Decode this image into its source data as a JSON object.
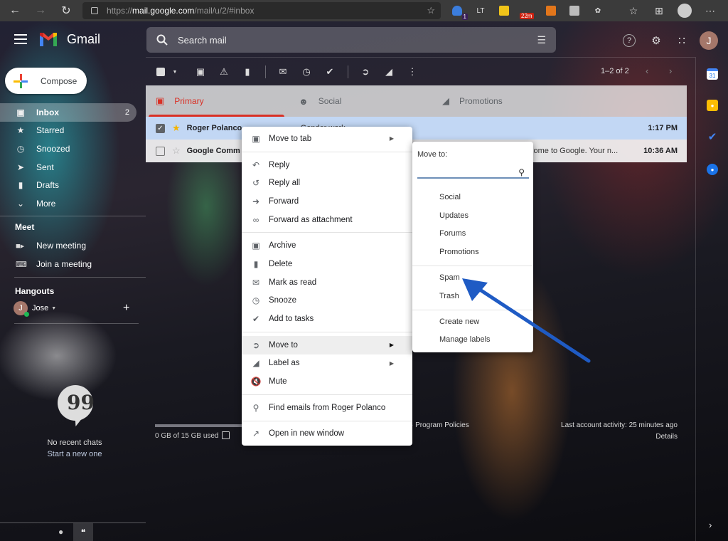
{
  "browser": {
    "url_prefix": "https://",
    "url_host": "mail.google.com",
    "url_path": "/mail/u/2/#inbox",
    "extensions": [
      {
        "name": "ext-blue",
        "badge": "1",
        "color": "#3b7ddd"
      },
      {
        "name": "ext-languagetool",
        "label": "LT"
      },
      {
        "name": "ext-yellow",
        "color": "#f0c419"
      },
      {
        "name": "ext-timer",
        "badge": "22m"
      },
      {
        "name": "ext-metamask",
        "color": "#e2761b"
      },
      {
        "name": "ext-gray",
        "color": "#bbbbbb"
      },
      {
        "name": "ext-puzzle"
      }
    ]
  },
  "gmail": {
    "app_name": "Gmail",
    "search_placeholder": "Search mail",
    "avatar_letter": "J"
  },
  "sidebar": {
    "compose": "Compose",
    "items": [
      {
        "label": "Inbox",
        "count": "2",
        "icon": "inbox-icon",
        "active": true
      },
      {
        "label": "Starred",
        "icon": "star-icon"
      },
      {
        "label": "Snoozed",
        "icon": "clock-icon"
      },
      {
        "label": "Sent",
        "icon": "send-icon"
      },
      {
        "label": "Drafts",
        "icon": "draft-icon"
      },
      {
        "label": "More",
        "icon": "chevron-down-icon"
      }
    ],
    "meet": {
      "title": "Meet",
      "new_meeting": "New meeting",
      "join_meeting": "Join a meeting"
    },
    "hangouts": {
      "title": "Hangouts",
      "user": "Jose",
      "user_initial": "J",
      "no_chats": "No recent chats",
      "start_new": "Start a new one"
    }
  },
  "toolbar": {
    "pager": "1–2 of 2"
  },
  "tabs": [
    {
      "label": "Primary",
      "active": true
    },
    {
      "label": "Social"
    },
    {
      "label": "Promotions"
    }
  ],
  "emails": [
    {
      "from": "Roger Polanco",
      "subject": "Gender work",
      "time": "1:17 PM",
      "selected": true,
      "starred": true
    },
    {
      "from": "Google Comm",
      "subject": "come to Google. Your n...",
      "time": "10:36 AM",
      "selected": false,
      "starred": false
    }
  ],
  "footer": {
    "storage": "0 GB of 15 GB used",
    "storage_used_fraction": 0,
    "policies": "· Program Policies",
    "activity": "Last account activity: 25 minutes ago",
    "details": "Details"
  },
  "context_menu": {
    "groups": [
      [
        {
          "label": "Move to tab",
          "submenu": true,
          "icon": "move-to-tab-icon"
        }
      ],
      [
        {
          "label": "Reply",
          "icon": "reply-icon"
        },
        {
          "label": "Reply all",
          "icon": "reply-all-icon"
        },
        {
          "label": "Forward",
          "icon": "forward-icon"
        },
        {
          "label": "Forward as attachment",
          "icon": "attachment-icon"
        }
      ],
      [
        {
          "label": "Archive",
          "icon": "archive-icon"
        },
        {
          "label": "Delete",
          "icon": "trash-icon"
        },
        {
          "label": "Mark as read",
          "icon": "mark-read-icon"
        },
        {
          "label": "Snooze",
          "icon": "clock-icon"
        },
        {
          "label": "Add to tasks",
          "icon": "add-task-icon"
        }
      ],
      [
        {
          "label": "Move to",
          "submenu": true,
          "highlighted": true,
          "icon": "move-to-icon"
        },
        {
          "label": "Label as",
          "submenu": true,
          "icon": "label-icon"
        },
        {
          "label": "Mute",
          "icon": "mute-icon"
        }
      ],
      [
        {
          "label": "Find emails from Roger Polanco",
          "icon": "search-icon"
        }
      ],
      [
        {
          "label": "Open in new window",
          "icon": "open-new-window-icon"
        }
      ]
    ]
  },
  "move_to_submenu": {
    "title": "Move to:",
    "search_value": "",
    "items_a": [
      "Social",
      "Updates",
      "Forums",
      "Promotions"
    ],
    "items_b": [
      "Spam",
      "Trash"
    ],
    "items_c": [
      "Create new",
      "Manage labels"
    ]
  },
  "annotation": {
    "arrow_color": "#1f5bc4",
    "points_to": "Spam"
  }
}
